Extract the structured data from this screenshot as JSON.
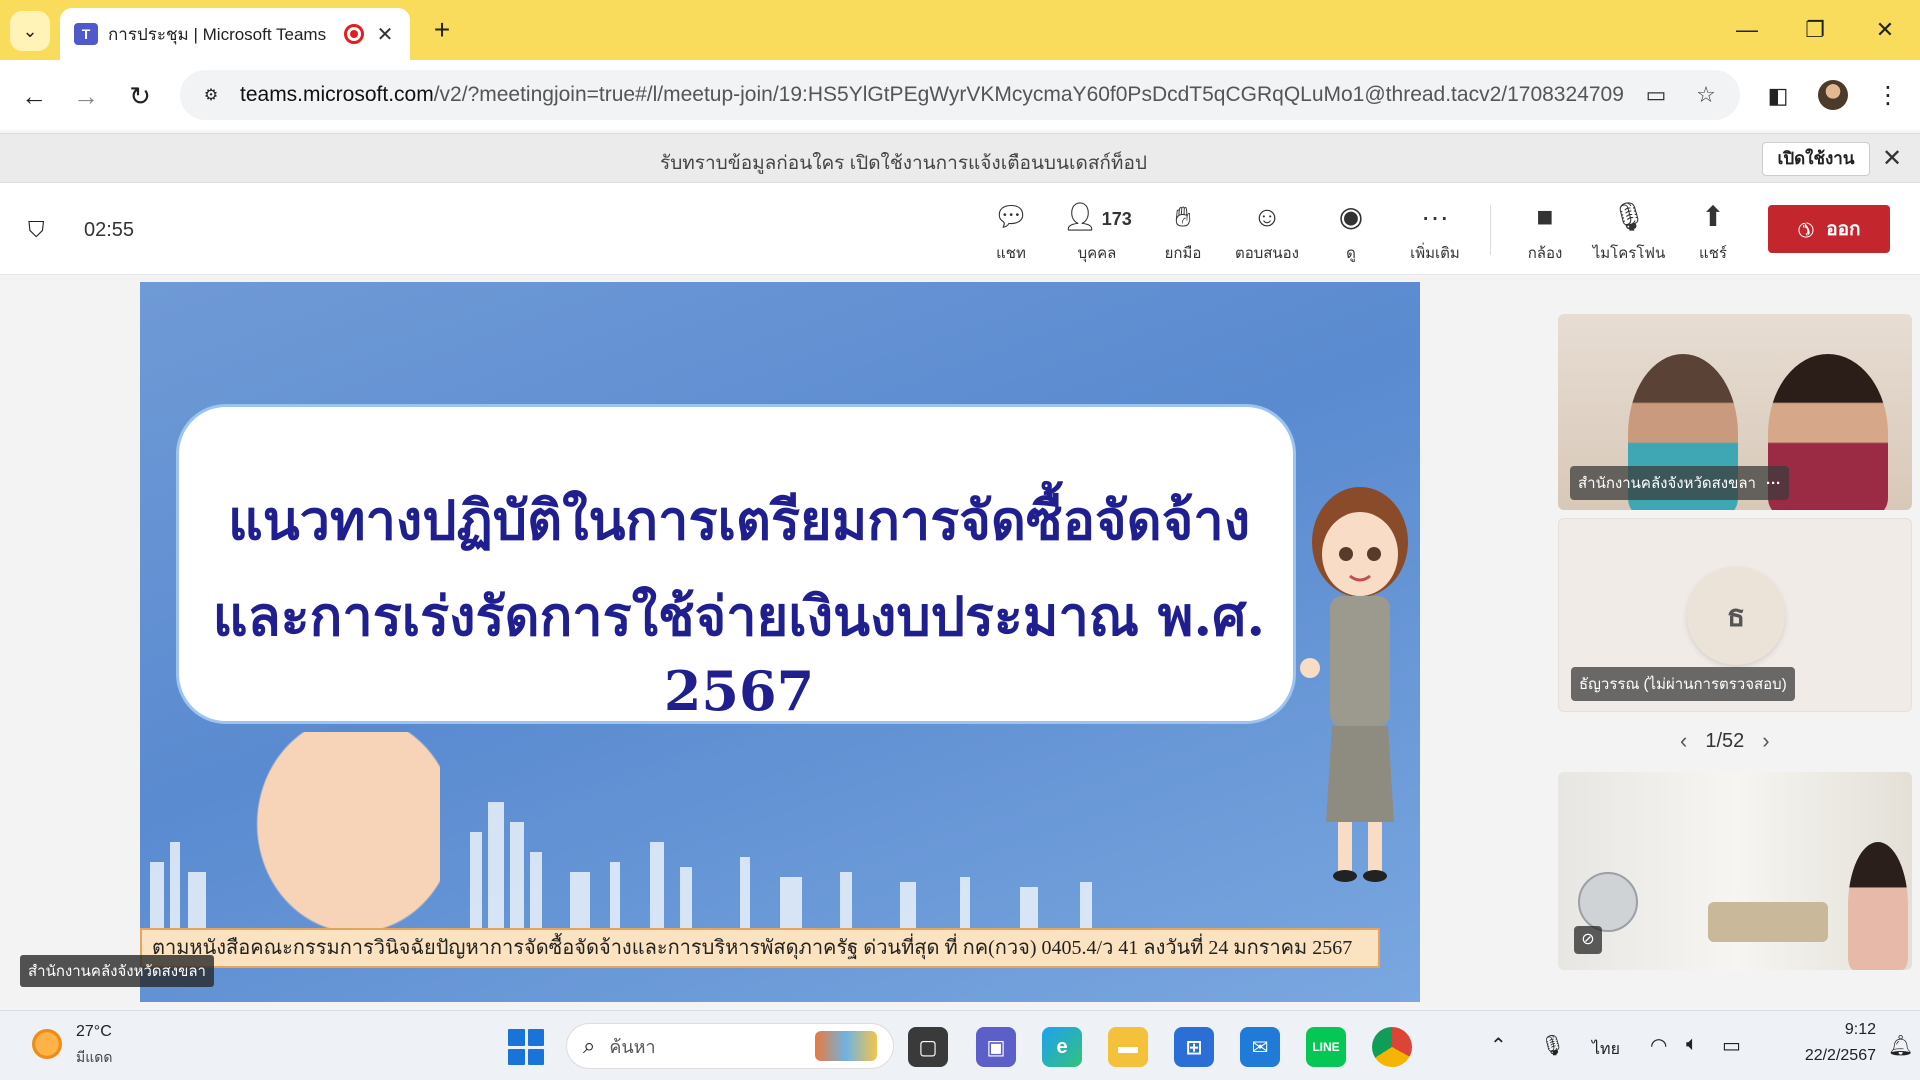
{
  "browser": {
    "tab_title": "การประชุม | Microsoft Teams",
    "favicon_text": "T",
    "url_domain": "teams.microsoft.com",
    "url_path": "/v2/?meetingjoin=true#/l/meetup-join/19:HS5YlGtPEgWyrVKMcycmaY60f0PsDcdT5qCGRqQLuMo1@thread.tacv2/17083247095...",
    "tab_close": "✕",
    "new_tab": "+",
    "minimize": "—",
    "restore": "❐",
    "close": "✕"
  },
  "notification": {
    "text": "รับทราบข้อมูลก่อนใคร เปิดใช้งานการแจ้งเตือนบนเดสก์ท็อป",
    "enable_label": "เปิดใช้งาน"
  },
  "meeting": {
    "timer": "02:55",
    "controls": {
      "chat": "แชท",
      "people": "บุคคล",
      "people_count": "173",
      "raise_hand": "ยกมือ",
      "react": "ตอบสนอง",
      "view": "ดู",
      "more": "เพิ่มเติม",
      "camera": "กล้อง",
      "mic": "ไมโครโฟน",
      "share": "แชร์"
    },
    "leave_label": "ออก"
  },
  "slide": {
    "title_line1": "แนวทางปฏิบัติในการเตรียมการจัดซื้อจัดจ้าง",
    "title_line2": "และการเร่งรัดการใช้จ่ายเงินงบประมาณ พ.ศ. 2567",
    "caption": "ตามหนังสือคณะกรรมการวินิจฉัยปัญหาการจัดซื้อจัดจ้างและการบริหารพัสดุภาครัฐ ด่วนที่สุด ที่ กค(กวจ) 0405.4/ว 41 ลงวันที่ 24 มกราคม 2567"
  },
  "presenter_label": "สำนักงานคลังจังหวัดสงขลา",
  "participants": [
    {
      "name": "สำนักงานคลังจังหวัดสงขลา",
      "more": "···"
    },
    {
      "name": "ธัญวรรณ (ไม่ผ่านการตรวจสอบ)",
      "initial": "ธ"
    },
    {
      "name": ""
    }
  ],
  "pager": "1/52",
  "taskbar": {
    "weather_temp": "27°C",
    "weather_desc": "มีแดด",
    "search_placeholder": "ค้นหา",
    "language": "ไทย",
    "time": "9:12",
    "date": "22/2/2567"
  },
  "colors": {
    "tab_strip": "#f9dc5c",
    "leave_button": "#c4262e",
    "slide_title": "#1f1f8f",
    "slide_bg": "#5a8ad0"
  }
}
